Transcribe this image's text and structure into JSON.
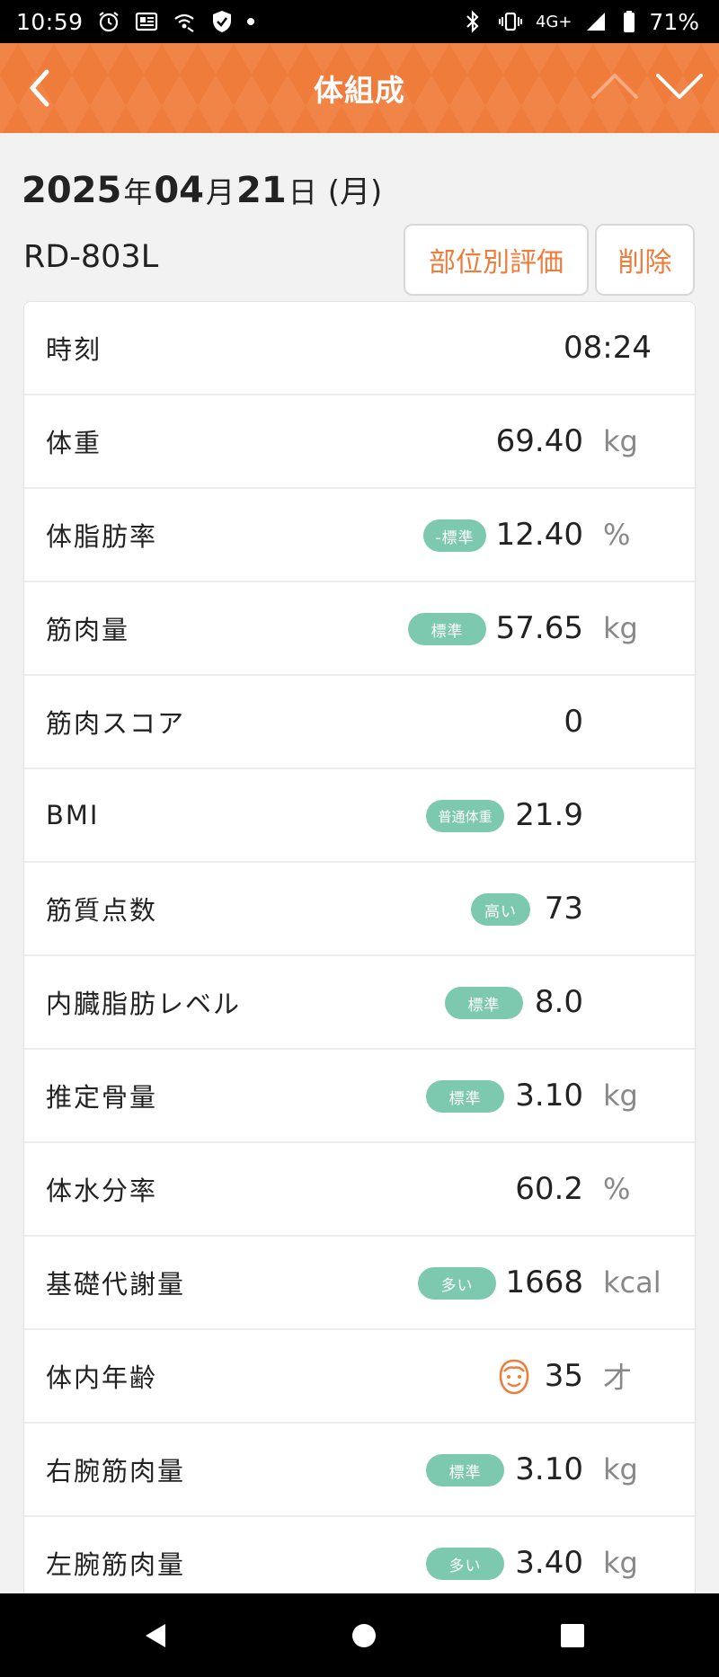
{
  "status_bar": {
    "time": "10:59",
    "network": "4G+",
    "battery": "71%",
    "icons": [
      "alarm-clock-icon",
      "news-icon",
      "wifi-call-icon",
      "shield-icon",
      "dot-icon",
      "bluetooth-icon",
      "vibrate-icon",
      "signal-icon",
      "battery-icon"
    ]
  },
  "header": {
    "title": "体組成",
    "color": "#f07c3c"
  },
  "date": {
    "year": "2025",
    "year_suffix": "年",
    "month": "04",
    "month_suffix": "月",
    "day": "21",
    "day_suffix": "日",
    "weekday": "(月)"
  },
  "device": {
    "model": "RD-803L"
  },
  "actions": {
    "eval_label": "部位別評価",
    "delete_label": "削除"
  },
  "rows": [
    {
      "label": "時刻",
      "value": "08:24",
      "unit": "",
      "badge": ""
    },
    {
      "label": "体重",
      "value": "69.40",
      "unit": "kg",
      "badge": ""
    },
    {
      "label": "体脂肪率",
      "value": "12.40",
      "unit": "%",
      "badge": "-標準"
    },
    {
      "label": "筋肉量",
      "value": "57.65",
      "unit": "kg",
      "badge": "標準"
    },
    {
      "label": "筋肉スコア",
      "value": "0",
      "unit": "",
      "badge": ""
    },
    {
      "label": "BMI",
      "value": "21.9",
      "unit": "",
      "badge": "普通体重"
    },
    {
      "label": "筋質点数",
      "value": "73",
      "unit": "",
      "badge": "高い"
    },
    {
      "label": "内臓脂肪レベル",
      "value": "8.0",
      "unit": "",
      "badge": "標準"
    },
    {
      "label": "推定骨量",
      "value": "3.10",
      "unit": "kg",
      "badge": "標準"
    },
    {
      "label": "体水分率",
      "value": "60.2",
      "unit": "%",
      "badge": ""
    },
    {
      "label": "基礎代謝量",
      "value": "1668",
      "unit": "kcal",
      "badge": "多い"
    },
    {
      "label": "体内年齢",
      "value": "35",
      "unit": "才",
      "badge": ""
    },
    {
      "label": "右腕筋肉量",
      "value": "3.10",
      "unit": "kg",
      "badge": "標準"
    },
    {
      "label": "左腕筋肉量",
      "value": "3.40",
      "unit": "kg",
      "badge": "多い"
    }
  ],
  "colors": {
    "accent": "#f07c3c",
    "badge": "#7dc9b0",
    "face_icon": "#ee7c3b"
  }
}
